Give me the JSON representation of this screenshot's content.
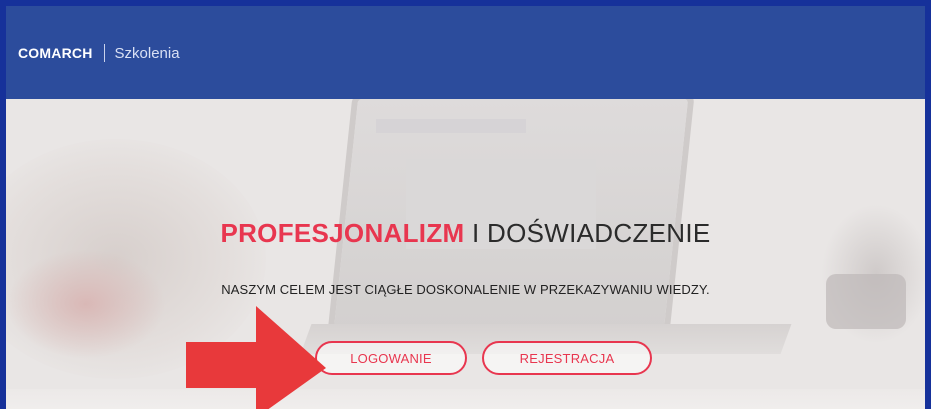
{
  "header": {
    "brand": "COMARCH",
    "section": "Szkolenia"
  },
  "hero": {
    "headline_accent": "PROFESJONALIZM",
    "headline_rest": " I DOŚWIADCZENIE",
    "subline": "NASZYM CELEM JEST CIĄGŁE DOSKONALENIE W PRZEKAZYWANIU WIEDZY.",
    "login_label": "LOGOWANIE",
    "register_label": "REJESTRACJA"
  },
  "colors": {
    "navbar": "#2c4c9c",
    "accent": "#e8364f",
    "annotation_arrow": "#e8393b"
  }
}
